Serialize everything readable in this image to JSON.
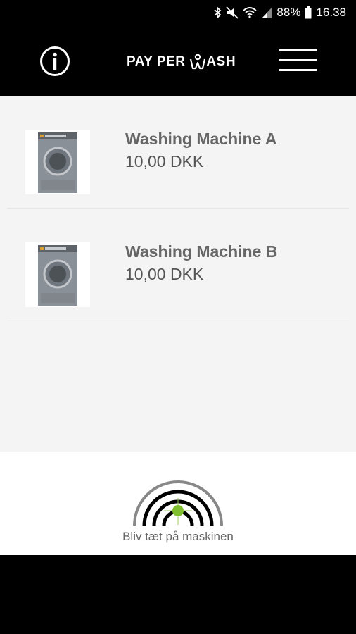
{
  "status": {
    "percent": "88%",
    "time": "16.38"
  },
  "header": {
    "logo_text": "PAY PER",
    "logo_suffix": "ASH"
  },
  "machines": [
    {
      "name": "Washing Machine A",
      "price": "10,00 DKK"
    },
    {
      "name": "Washing Machine B",
      "price": "10,00 DKK"
    }
  ],
  "footer": {
    "label": "Bliv tæt på maskinen"
  },
  "colors": {
    "background": "#f4f4f4",
    "header": "#000000",
    "accent": "#7fbf2f"
  }
}
